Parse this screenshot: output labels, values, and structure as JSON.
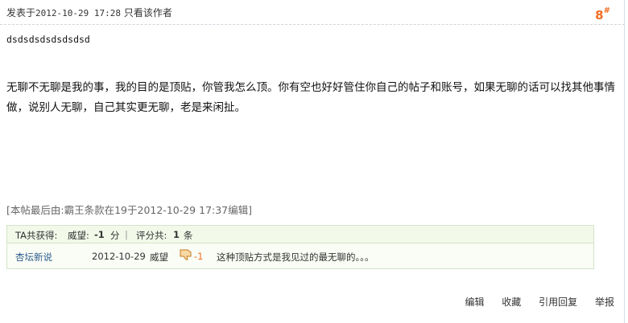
{
  "post": {
    "posted_prefix": "发表于",
    "posted_date": "2012-10-29 17:28",
    "only_author": "只看该作者",
    "floor_number": "8",
    "floor_symbol": "#",
    "first_line": "dsdsdsdsdsdsdsd",
    "content": "无聊不无聊是我的事，我的目的是顶贴，你管我怎么顶。你有空也好好管住你自己的帖子和账号，如果无聊的话可以找其他事情做，说别人无聊，自己其实更无聊，老是来闲扯。",
    "edit_note": "[本帖最后由:霸王条款在19于2012-10-29 17:37编辑]"
  },
  "rating": {
    "ta_label": "TA共获得:",
    "prestige_label": "威望:",
    "prestige_value": "-1",
    "prestige_unit": "分",
    "divider": "|",
    "count_label": "评分共:",
    "count_value": "1",
    "count_unit": "条",
    "entry": {
      "user": "杏坛新说",
      "date": "2012-10-29",
      "field": "威望",
      "thumb_icon": "thumb-down-icon",
      "score": "-1",
      "reason": "这种顶贴方式是我见过的最无聊的。。。"
    }
  },
  "actions": {
    "edit": "编辑",
    "favorite": "收藏",
    "quote_reply": "引用回复",
    "report": "举报"
  }
}
